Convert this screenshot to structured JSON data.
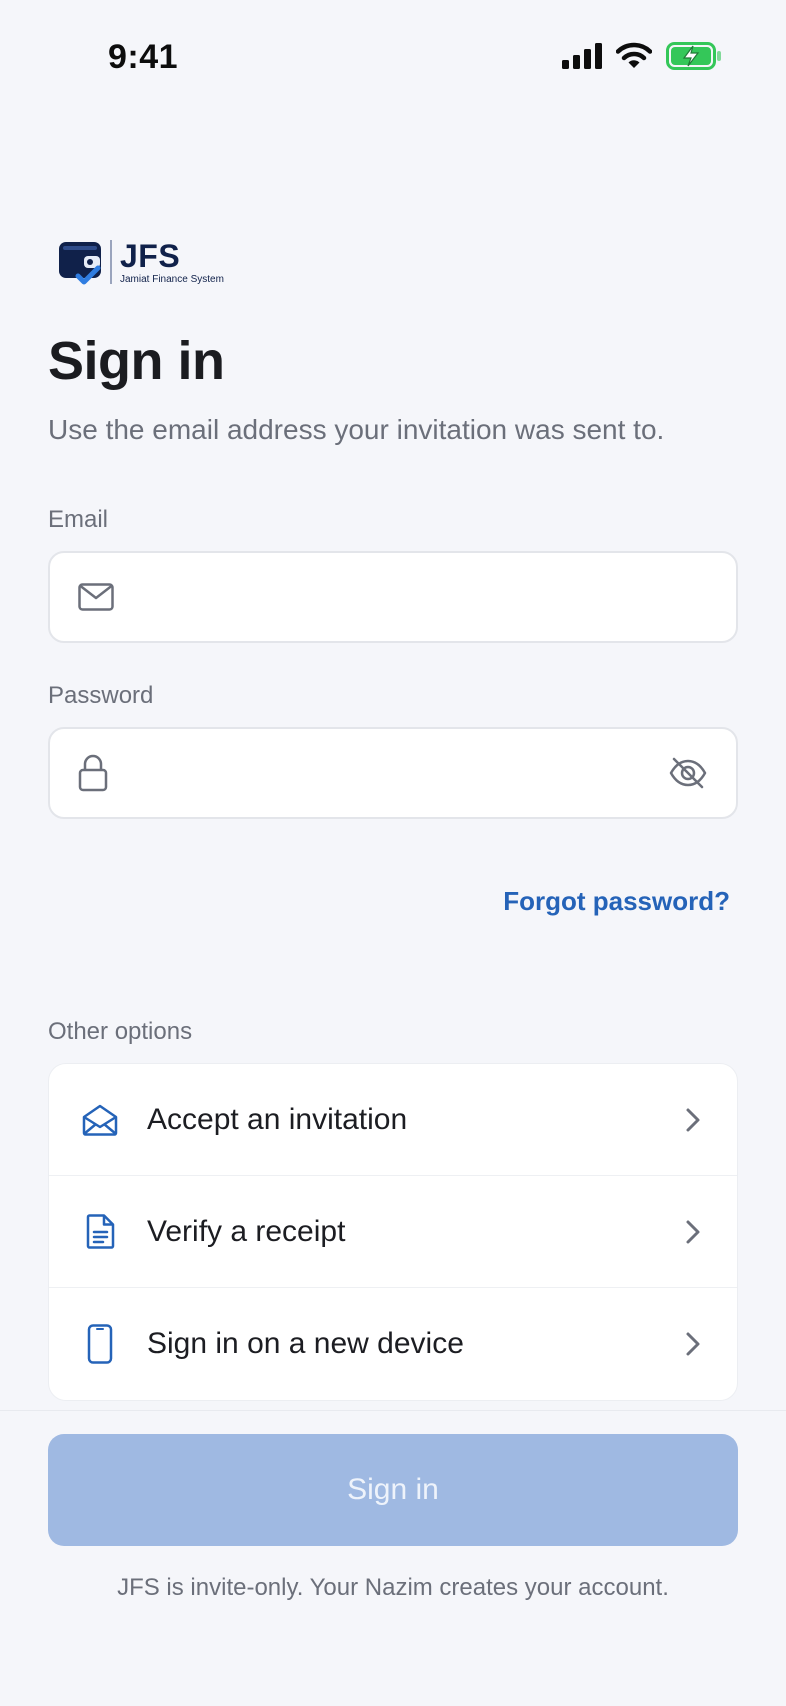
{
  "status_bar": {
    "time": "9:41",
    "icons": [
      "cellular-signal-icon",
      "wifi-icon",
      "battery-charging-icon"
    ],
    "battery_color": "#34c759"
  },
  "brand": {
    "title": "JFS",
    "subtitle": "Jamiat Finance System",
    "logo_icon": "wallet-check-icon",
    "primary_color": "#10214a",
    "accent_color": "#2f7de1"
  },
  "header": {
    "title": "Sign in",
    "subtitle": "Use the email address your invitation was sent to."
  },
  "form": {
    "email": {
      "label": "Email",
      "value": "",
      "placeholder": "",
      "icon": "mail-icon"
    },
    "password": {
      "label": "Password",
      "value": "",
      "placeholder": "",
      "icon": "lock-icon",
      "toggle_icon": "eye-off-icon"
    },
    "forgot_label": "Forgot password?"
  },
  "other_options": {
    "label": "Other options",
    "items": [
      {
        "label": "Accept an invitation",
        "icon": "envelope-open-icon"
      },
      {
        "label": "Verify a receipt",
        "icon": "document-icon"
      },
      {
        "label": "Sign in on a new device",
        "icon": "smartphone-icon"
      }
    ]
  },
  "actions": {
    "sign_in_label": "Sign in",
    "footnote": "JFS is invite-only. Your Nazim creates your account."
  },
  "colors": {
    "background": "#f5f6fa",
    "link": "#2563b8",
    "button_disabled": "#9fb9e2",
    "muted_text": "#6b6f7a"
  }
}
